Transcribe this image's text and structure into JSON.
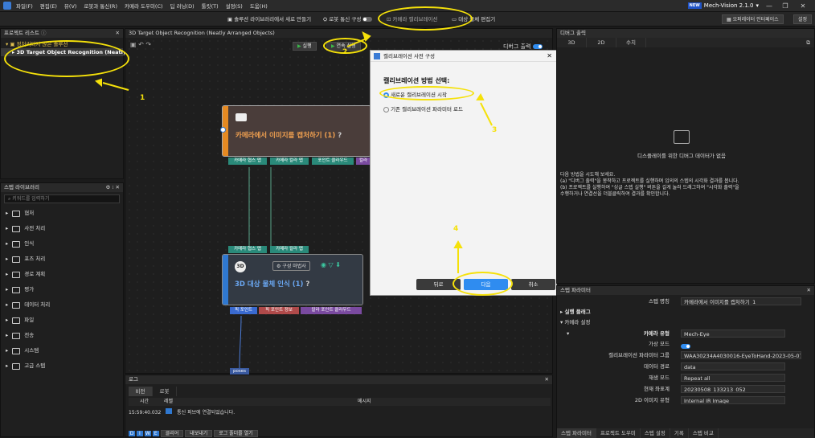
{
  "menu": [
    "파일(F)",
    "편집(E)",
    "뷰(V)",
    "로봇과 통신(R)",
    "카메라 도우미(C)",
    "딥 러닝(D)",
    "툴킷(T)",
    "설정(S)",
    "도움(H)"
  ],
  "brand": {
    "badge": "NEW",
    "name": "Mech-Vision 2.1.0",
    "dropdown": "▾"
  },
  "window_buttons": [
    "—",
    "❐",
    "✕"
  ],
  "toolbar": {
    "new_solution": "솔루션 라이브러리에서 새로 만들기",
    "robot_comm": "로봇 통신 구성",
    "camera_calib": "카메라 캘리브레이션",
    "target_editor": "대상 물체 편집기",
    "operator_if": "오퍼레이터 인터페이스",
    "settings": "설정"
  },
  "project_panel": {
    "title": "프로젝트 리스트",
    "solution": "정처리되지 않은 솔루션",
    "project": "3D Target Object Recognition (Neatly..."
  },
  "step_library": {
    "title": "스텝 라이브러리",
    "search_placeholder": "키워드를 입력하기",
    "items": [
      "협처",
      "사전 처리",
      "인식",
      "포즈 처리",
      "경로 계획",
      "평가",
      "데이터 처리",
      "파일",
      "전송",
      "시스템",
      "고급 스텝"
    ]
  },
  "canvas": {
    "title": "3D Target Object Recognition (Neatly Arranged Objects)",
    "run_button": "실행",
    "continuous_button": "연속 실행",
    "debug_label": "디버그 출력",
    "node1": {
      "title": "카메라에서 이미지를 캡처하기 (1)",
      "ports": [
        "카메라 협스 맵",
        "카메라 칼라 맵",
        "포인트 클라우드",
        "칼라"
      ]
    },
    "node2": {
      "title": "3D 대상 물체 인식 (1)",
      "config": "구성 마법사",
      "in_ports": [
        "카메라 협스 맵",
        "카메라 칼라 맵"
      ],
      "out_ports": [
        "픽 포인트",
        "픽 포인트 정보",
        "칼라 포인트 클라우드"
      ],
      "poses": "poses"
    }
  },
  "dialog": {
    "title": "캘리브레이션 사전 구성",
    "heading": "캘리브레이션 방법 선택:",
    "options": [
      "새로운 캘리브레이션 시작",
      "기존 캘리브레이션 파라미터 로드"
    ],
    "back": "뒤로",
    "next": "다음",
    "cancel": "취소"
  },
  "debug_panel": {
    "title": "디버그 출력",
    "tabs": [
      "3D",
      "2D",
      "수치"
    ],
    "empty": "디스플레이를 위한 디버그 데이터가 없음",
    "help_title": "다음 방법을 시도해 보세요.",
    "help_a": "(a) \"디버그 출력\"을 봉착하고 프로젝트를 실행하며 임의의 스텝의 시각화 결과를 봅니다.",
    "help_b": "(b) 프로젝트를 실행하여 \"싱글 스텝 실행\" 버튼을 길게 눌러 드래그하여 \"시각화 출력\"을",
    "help_c": "수행하거나 연결선을 더블클릭하여 결과를 확인합니다."
  },
  "params_panel": {
    "title": "스텝 파라미터",
    "step_name_label": "스텝 명칭",
    "step_name": "카메라에서 이미지를 캡처하기_1",
    "group1": "실행 플래그",
    "group2": "카메라 설정",
    "rows": [
      {
        "label": "카메라 유형",
        "value": "Mech-Eye"
      },
      {
        "label": "가상 모드",
        "value": ""
      },
      {
        "label": "캘리브레이션 파라미터 그룹",
        "value": "WAA30234A4030016-EyeToHand-2023-05-07"
      },
      {
        "label": "데이터 경로",
        "value": "data"
      },
      {
        "label": "재생 모드",
        "value": "Repeat all"
      },
      {
        "label": "현재 좌표계",
        "value": "20230508_133213_052"
      },
      {
        "label": "2D 이미지 유형",
        "value": "Internal IR Image"
      }
    ],
    "bottom_tabs": [
      "스텝 파라미터",
      "프로젝트 도우미",
      "스텝 설정",
      "기록",
      "스텝 비교"
    ]
  },
  "log_panel": {
    "title": "로그",
    "tabs": [
      "비전",
      "로봇"
    ],
    "col_time": "시간",
    "col_level": "레벨",
    "col_msg": "메시지",
    "row_time": "15:59:40.032",
    "row_msg": "통신 퍼브에 연결되었습니다.",
    "footer_levels": [
      "D",
      "I",
      "W",
      "E"
    ],
    "clear": "클리어",
    "export": "내보내기",
    "open_folder": "로그 폴더를 열기"
  },
  "annotations": [
    "1",
    "2",
    "3",
    "4"
  ],
  "colors": {
    "accent": "#2f8cf0",
    "annotation": "#f5e10a",
    "node1": "#e58a22",
    "node2": "#2f78d0"
  }
}
